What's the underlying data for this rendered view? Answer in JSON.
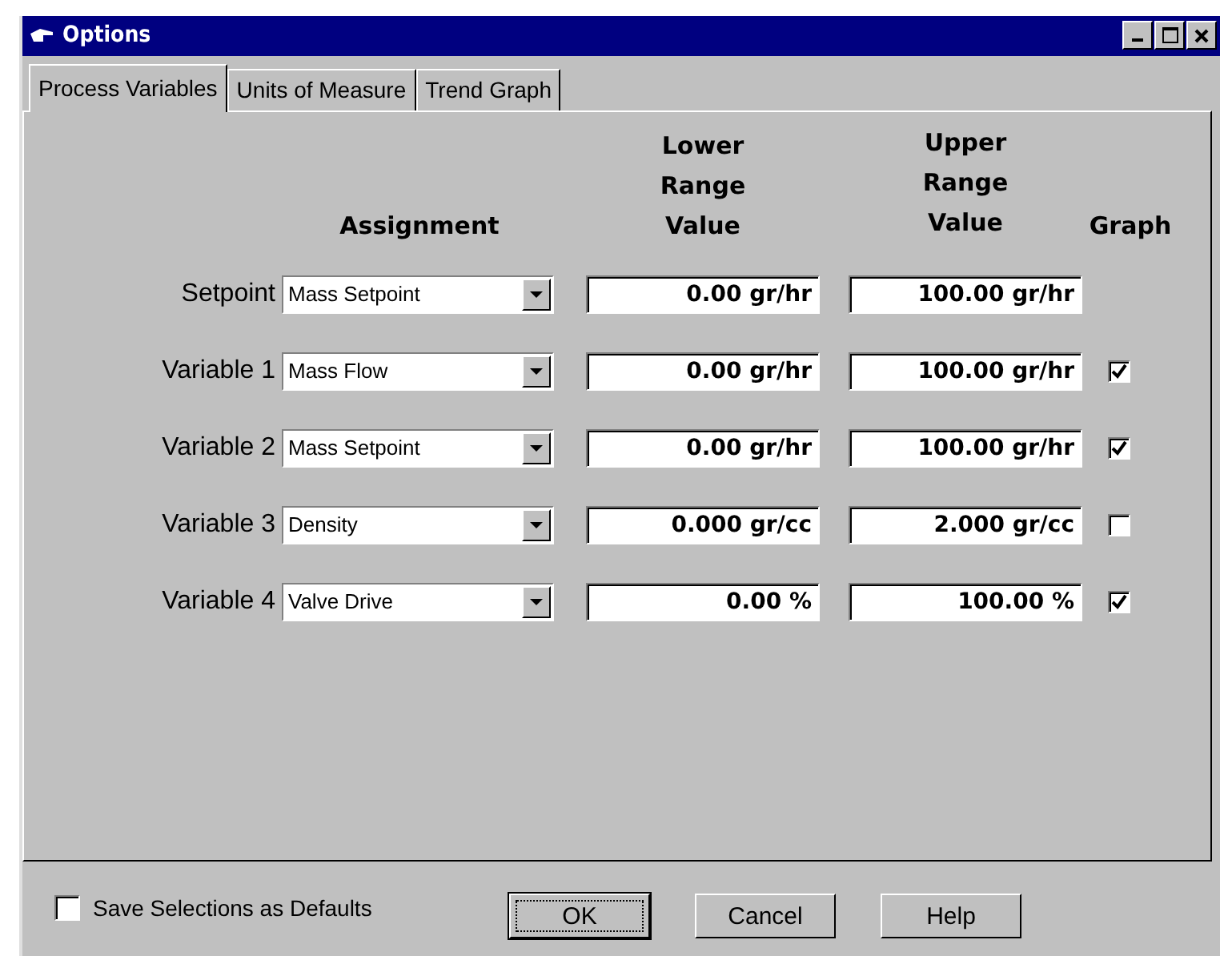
{
  "window": {
    "title": "Options"
  },
  "tabs": [
    {
      "label": "Process Variables",
      "selected": true
    },
    {
      "label": "Units of Measure",
      "selected": false
    },
    {
      "label": "Trend Graph",
      "selected": false
    }
  ],
  "headers": {
    "assignment": "Assignment",
    "lower": [
      "Lower",
      "Range",
      "Value"
    ],
    "upper": [
      "Upper",
      "Range",
      "Value"
    ],
    "graph": "Graph"
  },
  "rows": [
    {
      "label": "Setpoint",
      "assignment": "Mass Setpoint",
      "lower": "0.00 gr/hr",
      "upper": "100.00 gr/hr"
    },
    {
      "label": "Variable 1",
      "assignment": "Mass Flow",
      "lower": "0.00 gr/hr",
      "upper": "100.00 gr/hr",
      "graph": true
    },
    {
      "label": "Variable 2",
      "assignment": "Mass Setpoint",
      "lower": "0.00 gr/hr",
      "upper": "100.00 gr/hr",
      "graph": true
    },
    {
      "label": "Variable 3",
      "assignment": "Density",
      "lower": "0.000 gr/cc",
      "upper": "2.000 gr/cc",
      "graph": false
    },
    {
      "label": "Variable 4",
      "assignment": "Valve Drive",
      "lower": "0.00 %",
      "upper": "100.00 %",
      "graph": true
    }
  ],
  "save_defaults": {
    "label": "Save Selections as Defaults",
    "checked": false
  },
  "buttons": [
    "OK",
    "Cancel",
    "Help"
  ]
}
